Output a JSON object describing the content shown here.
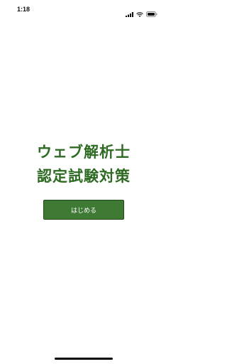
{
  "status_bar": {
    "time": "1:18",
    "icons": [
      "signal-icon",
      "wifi-icon",
      "battery-icon"
    ]
  },
  "main": {
    "title_line1": "ウェブ解析士",
    "title_line2": "認定試験対策",
    "start_button_label": "はじめる"
  },
  "colors": {
    "title": "#2e6b22",
    "button_bg": "#3f7a34",
    "button_text": "#ffffff",
    "background": "#ffffff"
  }
}
